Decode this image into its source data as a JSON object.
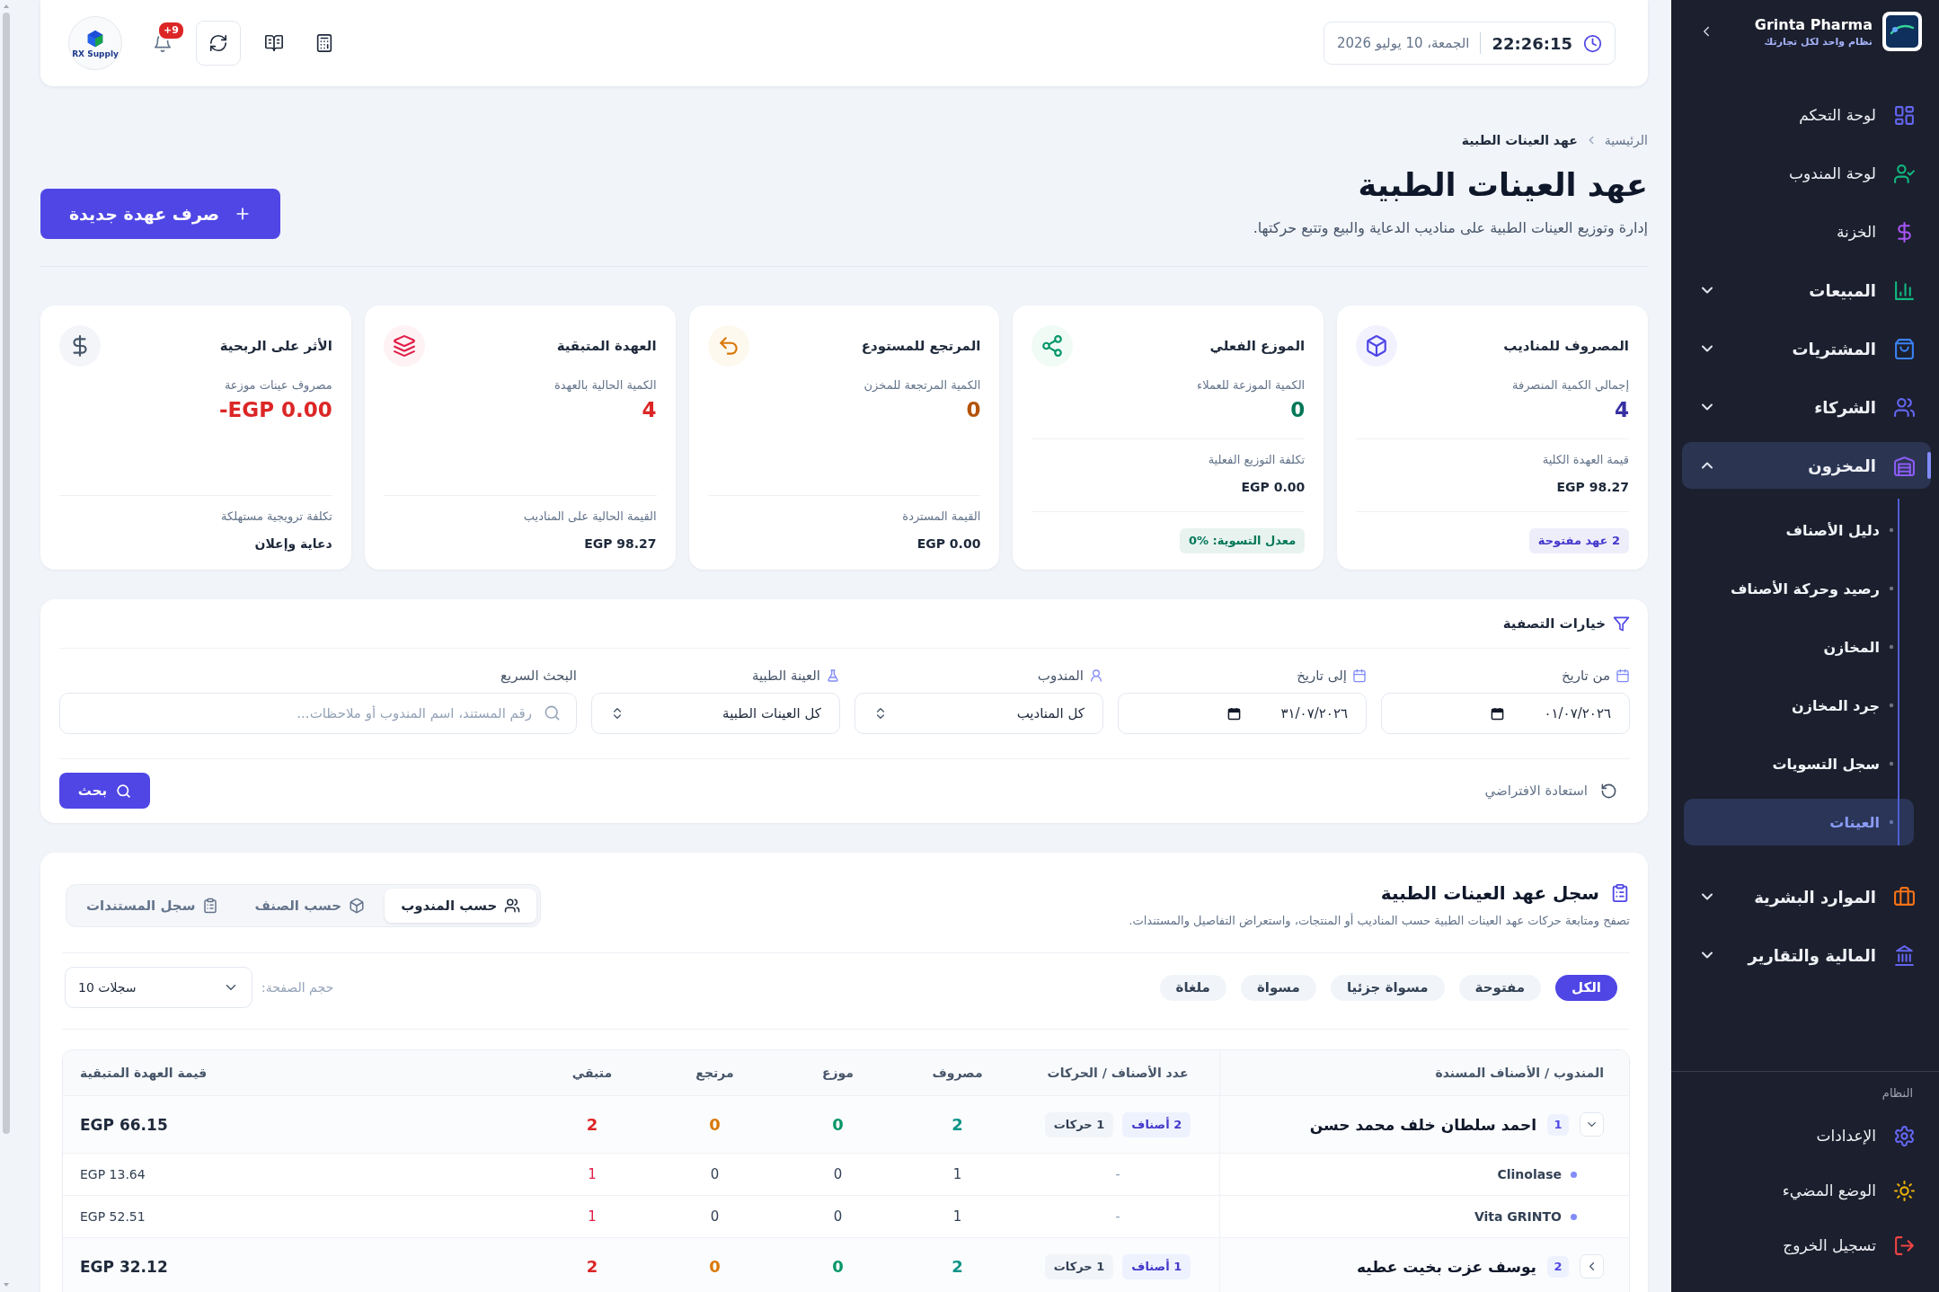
{
  "top_bar": {
    "time": "22:26:15",
    "date": "الجمعة، 10 يوليو 2026",
    "notification_count": "+9",
    "logo_text": "RX Supply"
  },
  "breadcrumb": [
    "الرئيسية",
    "عهد العينات الطبية"
  ],
  "header": {
    "title": "عهد العينات الطبية",
    "subtitle": "إدارة وتوزيع العينات الطبية على مناديب الدعاية والبيع وتتبع حركتها.",
    "action": "صرف عهدة جديدة"
  },
  "stat_cards": [
    {
      "title": "المصروف للمناديب",
      "label": "إجمالي الكمية المنصرفة",
      "value": "4",
      "color": "#3730a3",
      "detail": {
        "label": "قيمة العهدة الكلية",
        "value": "EGP 98.27"
      },
      "badge": {
        "text": "2 عهد مفتوحة",
        "color": "#4338ca"
      }
    },
    {
      "title": "الموزع الفعلي",
      "label": "الكمية الموزعة للعملاء",
      "value": "0",
      "color": "#047857",
      "detail": {
        "label": "تكلفة التوزيع الفعلية",
        "value": "EGP 0.00"
      },
      "badge": {
        "text": "معدل التسوية: %0",
        "color": "#047857"
      }
    },
    {
      "title": "المرتجع للمستودع",
      "label": "الكمية المرتجعة للمخزن",
      "value": "0",
      "color": "#b45309",
      "detail": {
        "label": "القيمة المستردة",
        "value": "EGP 0.00"
      }
    },
    {
      "title": "العهدة المتبقية",
      "label": "الكمية الحالية بالعهدة",
      "value": "4",
      "color": "#dc2626",
      "detail": {
        "label": "القيمة الحالية على المناديب",
        "value": "EGP 98.27"
      }
    },
    {
      "title": "الأثر على الربحية",
      "label": "مصروف عينات موزعة",
      "value": "-EGP 0.00",
      "color": "#dc2626",
      "detail": {
        "label": "تكلفة ترويجية مستهلكة",
        "value": "دعاية وإعلان"
      }
    }
  ],
  "filters": {
    "title": "خيارات التصفية",
    "fields": [
      {
        "kind": "date",
        "label": "من تاريخ",
        "value": "٠١/٠٧/٢٠٢٦"
      },
      {
        "kind": "date",
        "label": "إلى تاريخ",
        "value": "٣١/٠٧/٢٠٢٦"
      },
      {
        "kind": "select",
        "label": "المندوب",
        "value": "كل المناديب"
      },
      {
        "kind": "select",
        "label": "العينة الطبية",
        "value": "كل العينات الطبية"
      },
      {
        "kind": "search",
        "label": "البحث السريع",
        "placeholder": "رقم المستند، اسم المندوب أو ملاحظات..."
      }
    ],
    "reset": "استعادة الافتراضي",
    "submit": "بحث"
  },
  "log": {
    "title": "سجل عهد العينات الطبية",
    "subtitle": "تصفح ومتابعة حركات عهد العينات الطبية حسب المناديب أو المنتجات، واستعراض التفاصيل والمستندات.",
    "views": [
      {
        "label": "حسب المندوب",
        "selected": true
      },
      {
        "label": "حسب الصنف",
        "selected": false
      },
      {
        "label": "سجل المستندات",
        "selected": false
      }
    ],
    "statuses": [
      {
        "label": "الكل",
        "selected": true
      },
      {
        "label": "مفتوحة",
        "selected": false
      },
      {
        "label": "مسواة جزئيا",
        "selected": false
      },
      {
        "label": "مسواة",
        "selected": false
      },
      {
        "label": "ملغاة",
        "selected": false
      }
    ],
    "page_size": {
      "label": "حجم الصفحة:",
      "value": "10 سجلات"
    },
    "table": {
      "columns": [
        "المندوب / الأصناف المسندة",
        "عدد الأصناف / الحركات",
        "مصروف",
        "موزع",
        "مرتجع",
        "متبقي",
        "قيمة العهدة المتبقية"
      ],
      "rows": [
        {
          "index": "1",
          "name": "احمد سلطان خلف محمد حسن",
          "expanded": true,
          "items": "2 أصناف",
          "moves": "1 حركات",
          "issued": "2",
          "distributed": "0",
          "returned": "0",
          "remaining": "2",
          "value": "EGP 66.15",
          "children": [
            {
              "name": "Clinolase",
              "count": "-",
              "issued": "1",
              "distributed": "0",
              "returned": "0",
              "remaining": "1",
              "value": "EGP 13.64"
            },
            {
              "name": "Vita GRINTO",
              "count": "-",
              "issued": "1",
              "distributed": "0",
              "returned": "0",
              "remaining": "1",
              "value": "EGP 52.51"
            }
          ]
        },
        {
          "index": "2",
          "name": "يوسف عزت بخيت عطيه",
          "expanded": false,
          "items": "1 أصناف",
          "moves": "1 حركات",
          "issued": "2",
          "distributed": "0",
          "returned": "0",
          "remaining": "2",
          "value": "EGP 32.12"
        }
      ]
    }
  },
  "sidebar": {
    "brand": {
      "name": "Grinta Pharma",
      "tagline": "نظام واحد لكل تجارتك"
    },
    "items": [
      {
        "kind": "link",
        "label": "لوحة التحكم",
        "selected": false
      },
      {
        "kind": "link",
        "label": "لوحة المندوب",
        "selected": false
      },
      {
        "kind": "link",
        "label": "الخزنة",
        "selected": false
      },
      {
        "kind": "group",
        "label": "المبيعات",
        "selected": false,
        "expanded": false
      },
      {
        "kind": "group",
        "label": "المشتريات",
        "selected": false,
        "expanded": false
      },
      {
        "kind": "group",
        "label": "الشركاء",
        "selected": false,
        "expanded": false
      },
      {
        "kind": "group",
        "label": "المخزون",
        "selected": true,
        "expanded": true,
        "children": [
          {
            "label": "دليل الأصناف",
            "selected": false
          },
          {
            "label": "رصيد وحركة الأصناف",
            "selected": false
          },
          {
            "label": "المخازن",
            "selected": false
          },
          {
            "label": "جرد المخازن",
            "selected": false
          },
          {
            "label": "سجل التسويات",
            "selected": false
          },
          {
            "label": "العينات",
            "selected": true
          }
        ]
      },
      {
        "kind": "group",
        "label": "الموارد البشرية",
        "selected": false,
        "expanded": false
      },
      {
        "kind": "group",
        "label": "المالية والتقارير",
        "selected": false,
        "expanded": false
      }
    ],
    "system": {
      "title": "النظام",
      "items": [
        {
          "label": "الإعدادات",
          "selected": false
        },
        {
          "label": "الوضع المضيء",
          "selected": false
        },
        {
          "label": "تسجيل الخروج",
          "selected": false
        }
      ]
    }
  }
}
